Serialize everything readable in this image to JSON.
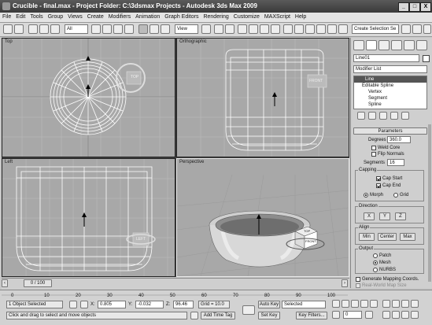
{
  "window": {
    "title": "Crucible - final.max    - Project Folder: C:\\3dsmax Projects    - Autodesk 3ds Max  2009",
    "min": "_",
    "max": "□",
    "close": "X"
  },
  "menu": [
    "File",
    "Edit",
    "Tools",
    "Group",
    "Views",
    "Create",
    "Modifiers",
    "Animation",
    "Graph Editors",
    "Rendering",
    "Customize",
    "MAXScript",
    "Help"
  ],
  "toolbar": {
    "filter": "All",
    "view": "View",
    "selection_set": "Create Selection Se"
  },
  "viewports": {
    "top": "Top",
    "ortho": "Orthographic",
    "left": "Left",
    "persp": "Perspective",
    "nav_front": "FRONT",
    "nav_top": "TOP",
    "nav_left": "LEFT"
  },
  "panel": {
    "object_name": "Line01",
    "modifier_list": "Modifier List",
    "stack": [
      "Line",
      "Editable Spline",
      "Vertex",
      "Segment",
      "Spline"
    ],
    "rollout": "Parameters",
    "degrees_label": "Degrees",
    "degrees": "360.0",
    "weld_core": "Weld Core",
    "flip_normals": "Flip Normals",
    "segments_label": "Segments",
    "segments": "16",
    "capping": "Capping",
    "cap_start": "Cap Start",
    "cap_end": "Cap End",
    "morph": "Morph",
    "grid": "Grid",
    "direction": "Direction",
    "dir_x": "X",
    "dir_y": "Y",
    "dir_z": "Z",
    "align": "Align",
    "min": "Min",
    "center": "Center",
    "max": "Max",
    "output": "Output",
    "patch": "Patch",
    "mesh": "Mesh",
    "nurbs": "NURBS",
    "gen_mapping": "Generate Mapping Coords.",
    "real_world": "Real-World Map Size",
    "gen_material": "Generate Material IDs"
  },
  "timeline": {
    "frame": "0 / 100",
    "ticks": [
      "0",
      "10",
      "20",
      "30",
      "40",
      "50",
      "60",
      "70",
      "80",
      "90",
      "100"
    ],
    "ticks_right": [
      "10",
      "45",
      "50",
      "55",
      "100"
    ]
  },
  "status": {
    "selected": "1 Object Selected",
    "prompt": "Click and drag to select and move objects",
    "x_label": "X:",
    "x": "0.805",
    "y_label": "Y:",
    "y": "-0.032",
    "z_label": "Z:",
    "z": "96.46",
    "grid": "Grid = 10.0",
    "add_time_tag": "Add Time Tag",
    "auto_key": "Auto Key",
    "selected_set": "Selected",
    "set_key": "Set Key",
    "key_filters": "Key Filters...",
    "frame_field": "0"
  }
}
